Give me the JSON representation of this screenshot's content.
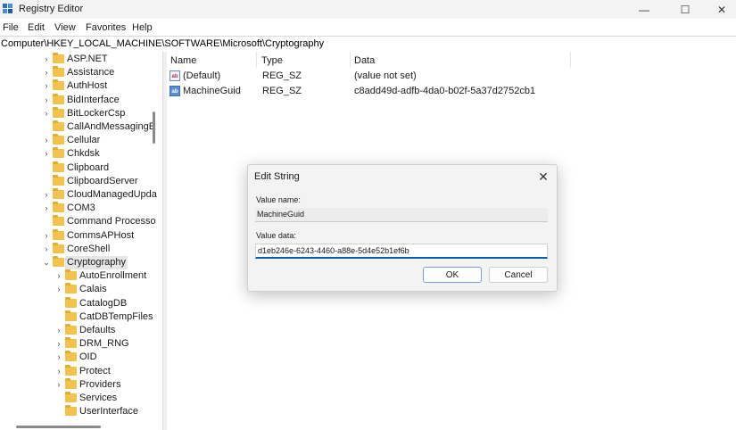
{
  "window": {
    "title": "Registry Editor",
    "minimize_glyph": "—",
    "maximize_glyph": "☐",
    "close_glyph": "✕"
  },
  "menu": [
    "File",
    "Edit",
    "View",
    "Favorites",
    "Help"
  ],
  "address": "Computer\\HKEY_LOCAL_MACHINE\\SOFTWARE\\Microsoft\\Cryptography",
  "tree": {
    "chevron_collapsed": "›",
    "chevron_expanded": "⌄",
    "items": [
      {
        "label": "ASP.NET",
        "level": 0,
        "expandable": true
      },
      {
        "label": "Assistance",
        "level": 0,
        "expandable": true
      },
      {
        "label": "AuthHost",
        "level": 0,
        "expandable": true
      },
      {
        "label": "BidInterface",
        "level": 0,
        "expandable": true
      },
      {
        "label": "BitLockerCsp",
        "level": 0,
        "expandable": true
      },
      {
        "label": "CallAndMessagingE",
        "level": 0,
        "expandable": false
      },
      {
        "label": "Cellular",
        "level": 0,
        "expandable": true
      },
      {
        "label": "Chkdsk",
        "level": 0,
        "expandable": true
      },
      {
        "label": "Clipboard",
        "level": 0,
        "expandable": false
      },
      {
        "label": "ClipboardServer",
        "level": 0,
        "expandable": false
      },
      {
        "label": "CloudManagedUpda",
        "level": 0,
        "expandable": true
      },
      {
        "label": "COM3",
        "level": 0,
        "expandable": true
      },
      {
        "label": "Command Processo",
        "level": 0,
        "expandable": false
      },
      {
        "label": "CommsAPHost",
        "level": 0,
        "expandable": true
      },
      {
        "label": "CoreShell",
        "level": 0,
        "expandable": true
      },
      {
        "label": "Cryptography",
        "level": 0,
        "expandable": true,
        "expanded": true,
        "selected": true
      },
      {
        "label": "AutoEnrollment",
        "level": 1,
        "expandable": true
      },
      {
        "label": "Calais",
        "level": 1,
        "expandable": true
      },
      {
        "label": "CatalogDB",
        "level": 1,
        "expandable": false
      },
      {
        "label": "CatDBTempFiles",
        "level": 1,
        "expandable": false
      },
      {
        "label": "Defaults",
        "level": 1,
        "expandable": true
      },
      {
        "label": "DRM_RNG",
        "level": 1,
        "expandable": true
      },
      {
        "label": "OID",
        "level": 1,
        "expandable": true
      },
      {
        "label": "Protect",
        "level": 1,
        "expandable": true
      },
      {
        "label": "Providers",
        "level": 1,
        "expandable": true
      },
      {
        "label": "Services",
        "level": 1,
        "expandable": false
      },
      {
        "label": "UserInterface",
        "level": 1,
        "expandable": false
      }
    ]
  },
  "list": {
    "columns": {
      "name": "Name",
      "type": "Type",
      "data": "Data"
    },
    "icon_text": "ab",
    "rows": [
      {
        "name": "(Default)",
        "type": "REG_SZ",
        "data": "(value not set)",
        "selected": false
      },
      {
        "name": "MachineGuid",
        "type": "REG_SZ",
        "data": "c8add49d-adfb-4da0-b02f-5a37d2752cb1",
        "selected": true
      }
    ]
  },
  "dialog": {
    "title": "Edit String",
    "close_glyph": "✕",
    "value_name_label": "Value name:",
    "value_name": "MachineGuid",
    "value_data_label": "Value data:",
    "value_data": "d1eb246e-6243-4460-a88e-5d4e52b1ef6b",
    "ok_label": "OK",
    "cancel_label": "Cancel"
  },
  "colors": {
    "accent": "#005fb8",
    "folder": "#f2c24c",
    "selection": "#e6e6e6"
  }
}
